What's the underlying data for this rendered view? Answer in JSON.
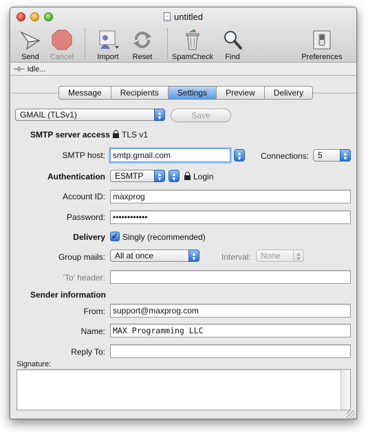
{
  "window": {
    "title": "untitled"
  },
  "toolbar": {
    "send": "Send",
    "cancel": "Cancel",
    "import": "Import",
    "reset": "Reset",
    "spamcheck": "SpamCheck",
    "find": "Find",
    "preferences": "Preferences"
  },
  "status": {
    "text": "Idle..."
  },
  "tabs": [
    {
      "label": "Message"
    },
    {
      "label": "Recipients"
    },
    {
      "label": "Settings"
    },
    {
      "label": "Preview"
    },
    {
      "label": "Delivery"
    }
  ],
  "active_tab": "Settings",
  "account_preset": {
    "value": "GMAIL (TLSv1)"
  },
  "save_label": "Save",
  "smtp": {
    "section_label": "SMTP server access",
    "tls_label": "TLS v1",
    "host_label": "SMTP host:",
    "host_value": "smtp.gmail.com",
    "connections_label": "Connections:",
    "connections_value": "5"
  },
  "auth": {
    "label": "Authentication",
    "method": "ESMTP",
    "login_label": "Login",
    "account_label": "Account ID:",
    "account_value": "maxprog",
    "password_label": "Password:",
    "password_value": "••••••••••••"
  },
  "delivery": {
    "label": "Delivery",
    "singly_label": "Singly (recommended)",
    "singly_checked": true,
    "group_label": "Group mails:",
    "group_value": "All at once",
    "interval_label": "Interval:",
    "interval_value": "None",
    "to_header_label": "'To' header:",
    "to_header_value": ""
  },
  "sender": {
    "section_label": "Sender information",
    "from_label": "From:",
    "from_value": "support@maxprog.com",
    "name_label": "Name:",
    "name_value": "MAX Programming LLC",
    "reply_label": "Reply To:",
    "reply_value": "",
    "signature_label": "Signature:",
    "signature_value": ""
  },
  "colors": {
    "accent": "#5f9be6",
    "stop": "#d93b33"
  }
}
